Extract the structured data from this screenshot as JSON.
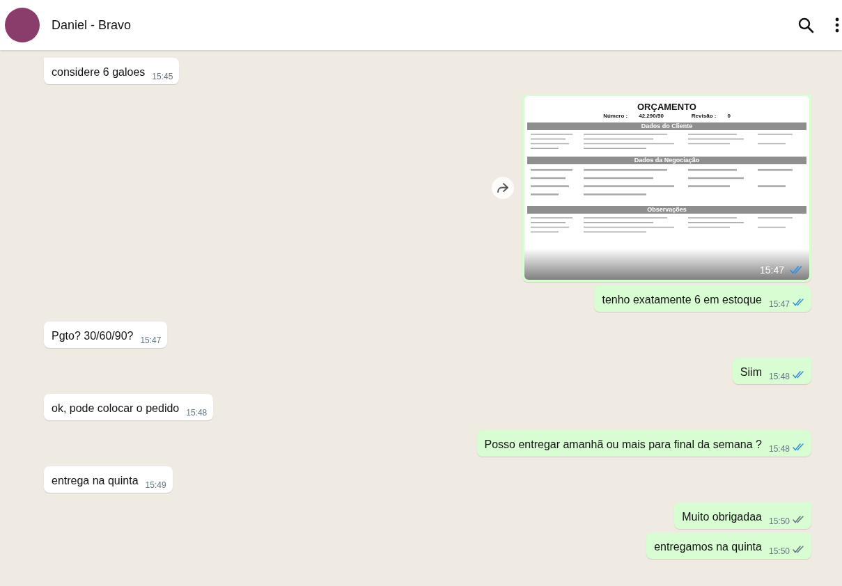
{
  "header": {
    "contact_name": "Daniel - Bravo"
  },
  "messages": [
    {
      "outgoing": false,
      "kind": "text",
      "text": "considere 6 galoes",
      "time": "15:45",
      "tail": true
    },
    {
      "outgoing": true,
      "kind": "image",
      "time": "15:47",
      "read": true,
      "tail": true,
      "document": {
        "title": "ORÇAMENTO",
        "number_label": "Número :",
        "number": "42.290/50",
        "revision_label": "Revisão :",
        "revision": "0",
        "sections": [
          "Dados do Cliente",
          "Dados da Negociação",
          "Observações"
        ]
      }
    },
    {
      "outgoing": true,
      "kind": "text",
      "text": "tenho exatamente 6 em estoque",
      "time": "15:47",
      "read": true,
      "tail": false
    },
    {
      "outgoing": false,
      "kind": "text",
      "text": "Pgto? 30/60/90?",
      "time": "15:47",
      "tail": false
    },
    {
      "outgoing": true,
      "kind": "text",
      "text": "Siim",
      "time": "15:48",
      "read": true,
      "tail": true
    },
    {
      "outgoing": false,
      "kind": "text",
      "text": "ok, pode colocar o pedido",
      "time": "15:48",
      "tail": false
    },
    {
      "outgoing": true,
      "kind": "text",
      "text": "Posso entregar amanhã ou mais para final da semana ?",
      "time": "15:48",
      "read": true,
      "tail": false
    },
    {
      "outgoing": false,
      "kind": "text",
      "text": "entrega na quinta",
      "time": "15:49",
      "tail": false
    },
    {
      "outgoing": true,
      "kind": "text",
      "text": "Muito obrigadaa",
      "time": "15:50",
      "read": false,
      "tail": true
    },
    {
      "outgoing": true,
      "kind": "text",
      "text": "entregamos na quinta",
      "time": "15:50",
      "read": false,
      "tail": false
    }
  ]
}
